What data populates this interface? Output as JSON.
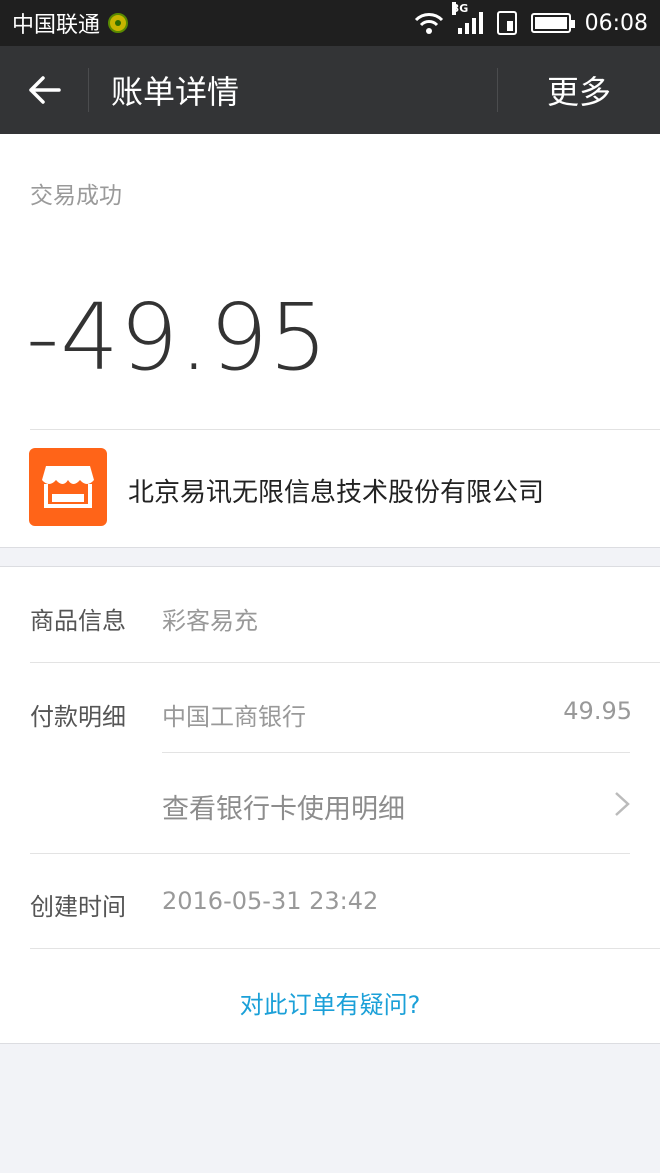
{
  "status_bar": {
    "carrier": "中国联通",
    "network": "3G",
    "time": "06:08"
  },
  "header": {
    "title": "账单详情",
    "more_label": "更多"
  },
  "summary": {
    "status": "交易成功",
    "amount": "-49.95",
    "merchant_name": "北京易讯无限信息技术股份有限公司",
    "merchant_icon": "shop-icon",
    "merchant_icon_color": "#ff6418"
  },
  "details": {
    "product": {
      "label": "商品信息",
      "value": "彩客易充"
    },
    "payment": {
      "label": "付款明细",
      "bank": "中国工商银行",
      "amount": "49.95",
      "bank_card_link": "查看银行卡使用明细"
    },
    "created": {
      "label": "创建时间",
      "value": "2016-05-31 23:42"
    },
    "question_link": "对此订单有疑问?",
    "link_color": "#1ba0d8"
  }
}
